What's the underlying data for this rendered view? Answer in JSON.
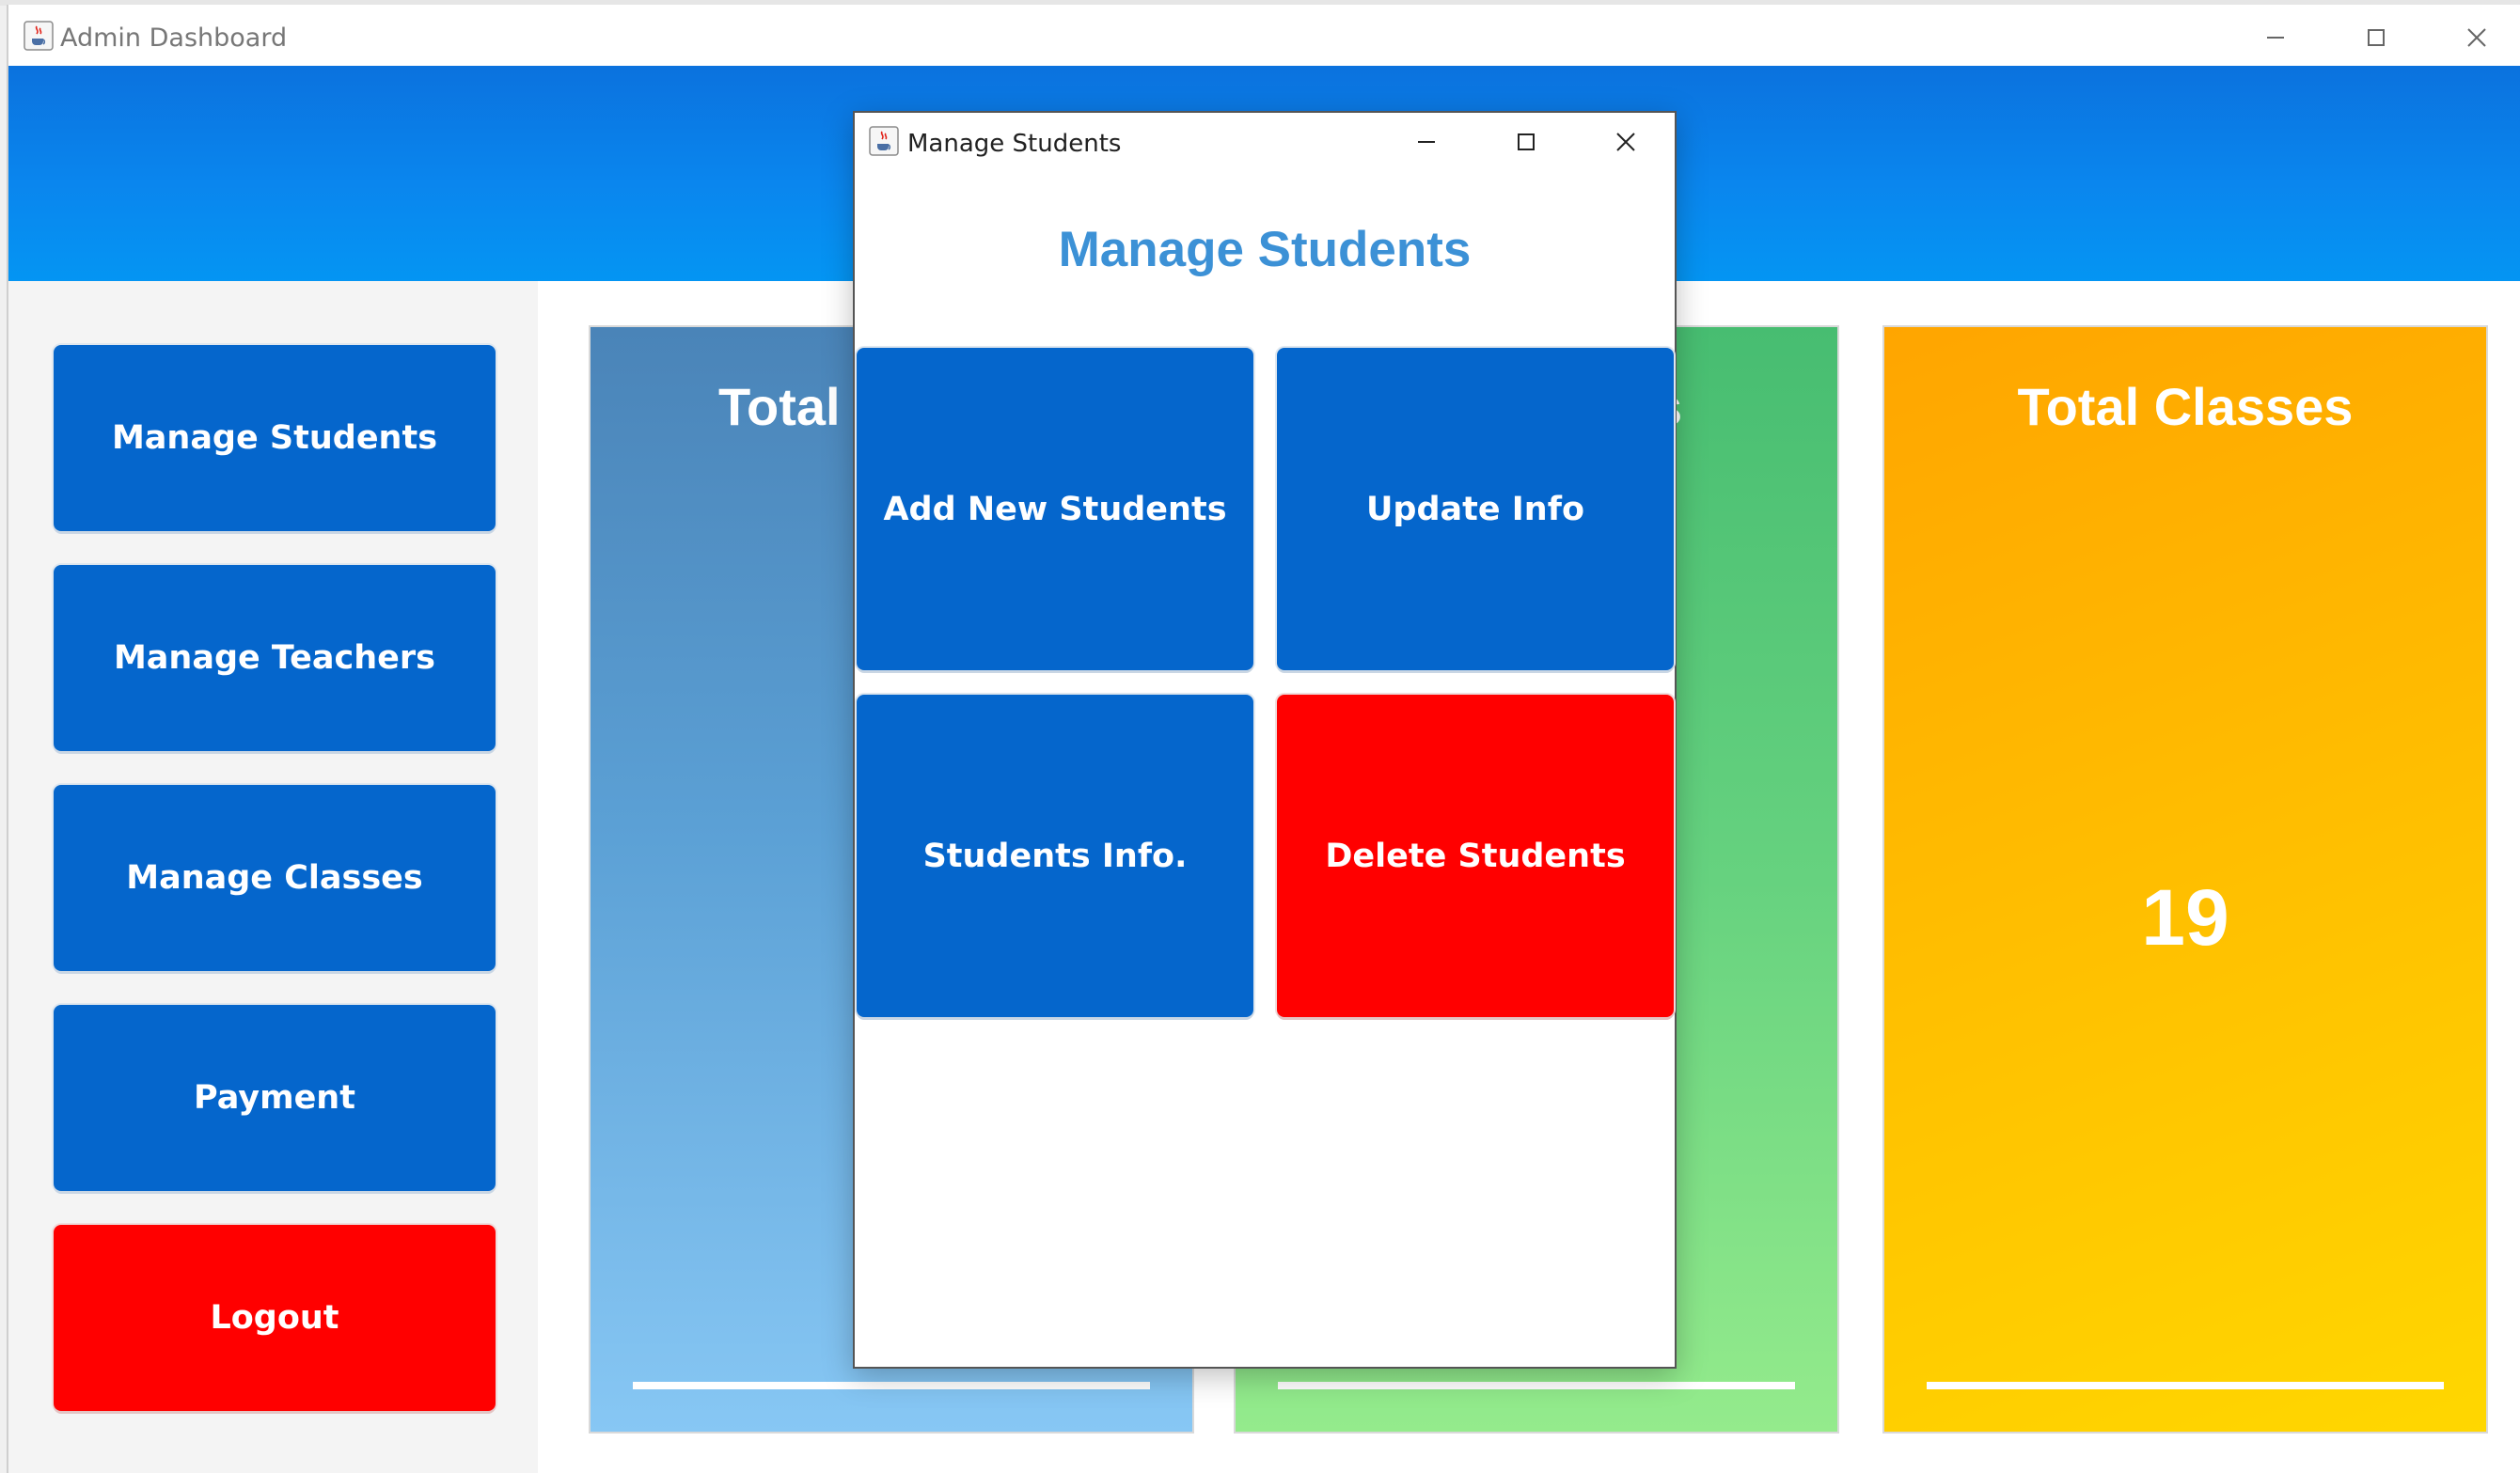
{
  "main_window": {
    "title": "Admin Dashboard",
    "icon": "java-cup-icon"
  },
  "sidebar": {
    "items": [
      {
        "label": "Manage Students",
        "color": "#0566cc"
      },
      {
        "label": "Manage Teachers",
        "color": "#0566cc"
      },
      {
        "label": "Manage Classes",
        "color": "#0566cc"
      },
      {
        "label": "Payment",
        "color": "#0566cc"
      },
      {
        "label": "Logout",
        "color": "#ff0000"
      }
    ]
  },
  "cards": [
    {
      "title": "Total Students",
      "visible_title": "Total S",
      "value": "",
      "color": "#5ba0d5"
    },
    {
      "title": "Total Teachers",
      "visible_title": "s",
      "value": "",
      "color": "#66d27f"
    },
    {
      "title": "Total Classes",
      "value": "19",
      "color": "#ffc100"
    }
  ],
  "dialog": {
    "title": "Manage Students",
    "heading": "Manage Students",
    "heading_color": "#3c91d6",
    "buttons": [
      {
        "label": "Add New Students",
        "color": "#0566cc"
      },
      {
        "label": "Update Info",
        "color": "#0566cc"
      },
      {
        "label": "Students Info.",
        "color": "#0566cc"
      },
      {
        "label": "Delete Students",
        "color": "#ff0000"
      }
    ]
  }
}
